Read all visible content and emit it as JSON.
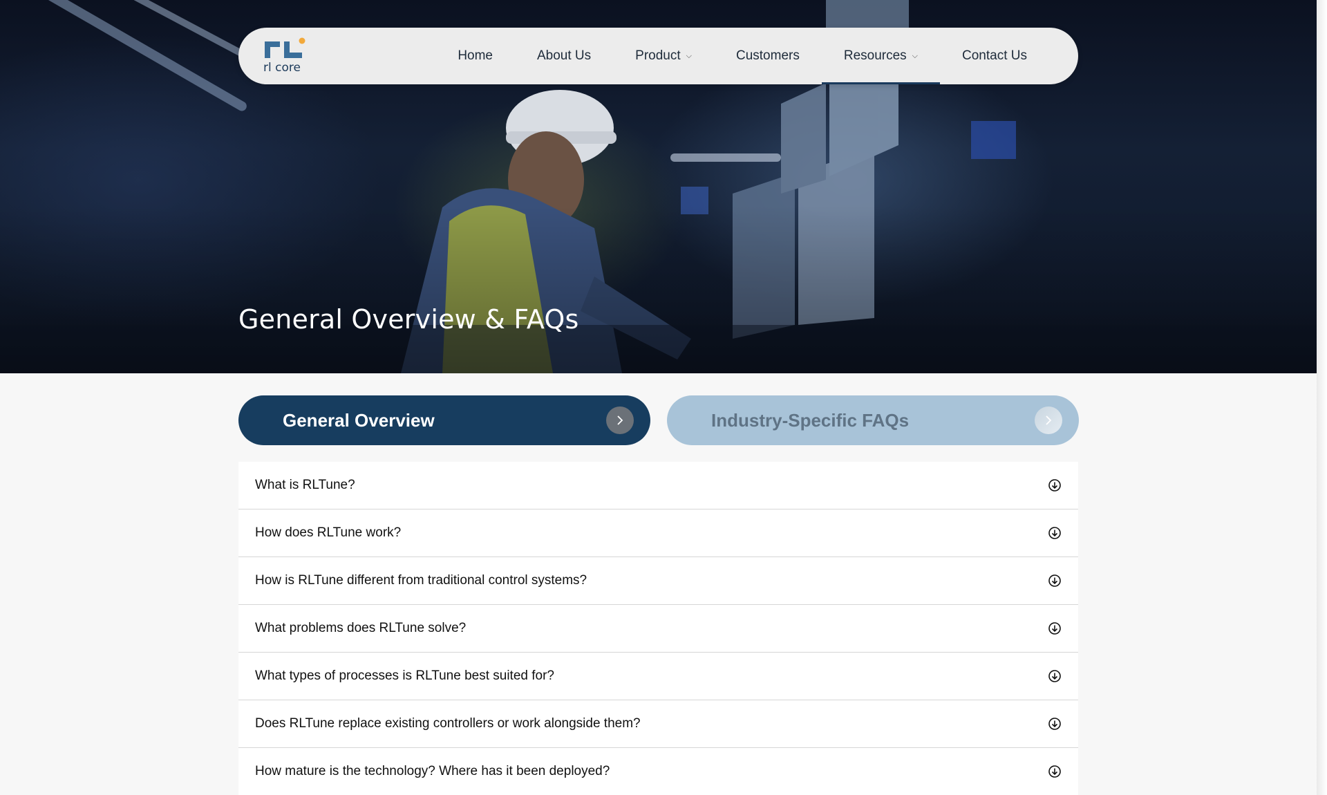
{
  "brand": {
    "logo_text": "rl core",
    "accent_dot": "#f2a93b",
    "mark_color": "#3a6e9a"
  },
  "nav": {
    "items": [
      {
        "label": "Home",
        "dropdown": false
      },
      {
        "label": "About Us",
        "dropdown": false
      },
      {
        "label": "Product",
        "dropdown": true
      },
      {
        "label": "Customers",
        "dropdown": false
      },
      {
        "label": "Resources",
        "dropdown": true,
        "active": true
      },
      {
        "label": "Contact Us",
        "dropdown": false
      }
    ]
  },
  "hero": {
    "title": "General Overview & FAQs"
  },
  "tabs": {
    "general": "General Overview",
    "industry": "Industry-Specific FAQs"
  },
  "faq": {
    "questions": [
      "What is RLTune?",
      "How does RLTune work?",
      "How is RLTune different from traditional control systems?",
      "What problems does RLTune solve?",
      "What types of processes is RLTune best suited for?",
      "Does RLTune replace existing controllers or work alongside them?",
      "How mature is the technology? Where has it been deployed?"
    ]
  },
  "colors": {
    "primary": "#173d5f",
    "tab_inactive": "#a8c3d8",
    "page_bg": "#f7f7f7"
  },
  "icons": {
    "expand": "circle-arrow-down-icon",
    "tab_arrow": "chevron-right-icon",
    "nav_dropdown": "chevron-down-icon"
  }
}
